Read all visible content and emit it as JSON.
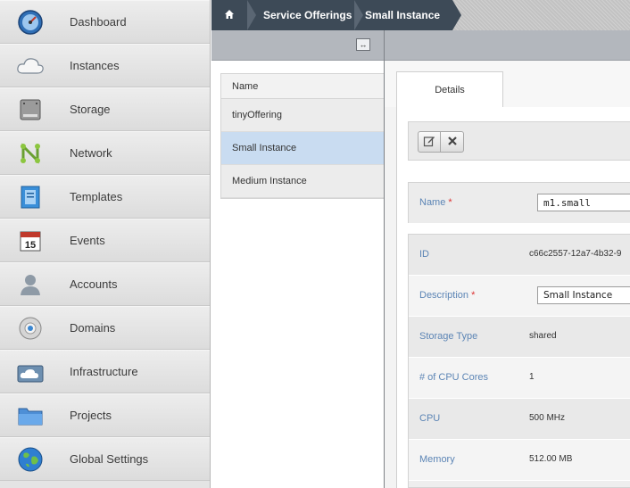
{
  "sidebar": {
    "items": [
      {
        "label": "Dashboard",
        "icon": "dashboard-icon"
      },
      {
        "label": "Instances",
        "icon": "cloud-icon"
      },
      {
        "label": "Storage",
        "icon": "storage-icon"
      },
      {
        "label": "Network",
        "icon": "network-icon"
      },
      {
        "label": "Templates",
        "icon": "templates-icon"
      },
      {
        "label": "Events",
        "icon": "calendar-icon"
      },
      {
        "label": "Accounts",
        "icon": "user-icon"
      },
      {
        "label": "Domains",
        "icon": "domain-icon"
      },
      {
        "label": "Infrastructure",
        "icon": "infrastructure-icon"
      },
      {
        "label": "Projects",
        "icon": "folder-icon"
      },
      {
        "label": "Global Settings",
        "icon": "globe-icon"
      }
    ],
    "events_day": "15"
  },
  "breadcrumb": {
    "home_icon": "home-icon",
    "items": [
      "Service Offerings",
      "Small Instance"
    ]
  },
  "list": {
    "header": "Name",
    "rows": [
      "tinyOffering",
      "Small Instance",
      "Medium Instance"
    ],
    "selected_index": 1
  },
  "detail": {
    "tab": "Details",
    "actions": {
      "edit_icon": "edit-icon",
      "delete_icon": "delete-icon"
    },
    "name": {
      "label": "Name",
      "required": "*",
      "value": "m1.small"
    },
    "fields": {
      "id": {
        "label": "ID",
        "value": "c66c2557-12a7-4b32-9"
      },
      "description": {
        "label": "Description",
        "required": "*",
        "value": "Small Instance"
      },
      "storage_type": {
        "label": "Storage Type",
        "value": "shared"
      },
      "cpu_cores": {
        "label": "# of CPU Cores",
        "value": "1"
      },
      "cpu": {
        "label": "CPU",
        "value": "500 MHz"
      },
      "memory": {
        "label": "Memory",
        "value": "512.00 MB"
      }
    }
  },
  "colors": {
    "breadcrumb_bg": "#3d4a57",
    "selected_row": "#c9dcf1",
    "label_blue": "#5c85b5",
    "required_red": "#dd3333"
  }
}
